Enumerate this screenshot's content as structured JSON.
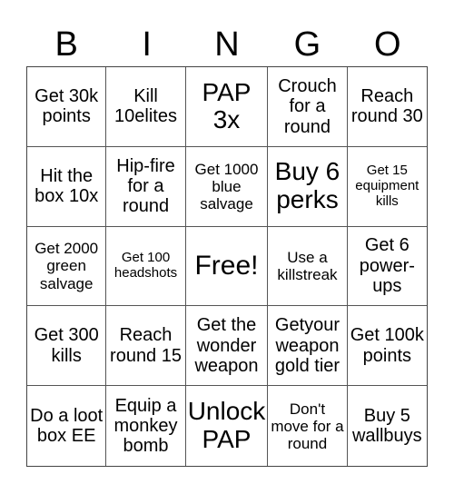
{
  "header": [
    "B",
    "I",
    "N",
    "G",
    "O"
  ],
  "cells": [
    {
      "text": "Get 30k points",
      "size": "fs-md"
    },
    {
      "text": "Kill 10elites",
      "size": "fs-md"
    },
    {
      "text": "PAP 3x",
      "size": "fs-lg"
    },
    {
      "text": "Crouch for a round",
      "size": "fs-md"
    },
    {
      "text": "Reach round 30",
      "size": "fs-md"
    },
    {
      "text": "Hit the box 10x",
      "size": "fs-md"
    },
    {
      "text": "Hip-fire for a round",
      "size": "fs-md"
    },
    {
      "text": "Get 1000 blue salvage",
      "size": "fs-sm"
    },
    {
      "text": "Buy 6 perks",
      "size": "fs-lg"
    },
    {
      "text": "Get 15 equipment kills",
      "size": "fs-xs"
    },
    {
      "text": "Get 2000 green salvage",
      "size": "fs-sm"
    },
    {
      "text": "Get 100 headshots",
      "size": "fs-xs"
    },
    {
      "text": "Free!",
      "size": "fs-xl"
    },
    {
      "text": "Use a killstreak",
      "size": "fs-sm"
    },
    {
      "text": "Get 6 power-ups",
      "size": "fs-md"
    },
    {
      "text": "Get 300 kills",
      "size": "fs-md"
    },
    {
      "text": "Reach round 15",
      "size": "fs-md"
    },
    {
      "text": "Get the wonder weapon",
      "size": "fs-md"
    },
    {
      "text": "Getyour weapon gold tier",
      "size": "fs-md"
    },
    {
      "text": "Get 100k points",
      "size": "fs-md"
    },
    {
      "text": "Do a loot box EE",
      "size": "fs-md"
    },
    {
      "text": "Equip a monkey bomb",
      "size": "fs-md"
    },
    {
      "text": "Unlock PAP",
      "size": "fs-lg"
    },
    {
      "text": "Don't move for a round",
      "size": "fs-sm"
    },
    {
      "text": "Buy 5 wallbuys",
      "size": "fs-md"
    }
  ]
}
